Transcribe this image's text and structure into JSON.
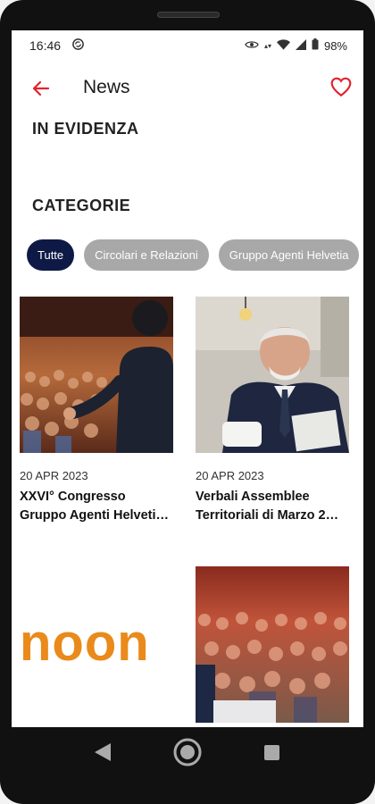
{
  "status": {
    "time": "16:46",
    "battery": "98%"
  },
  "appbar": {
    "title": "News"
  },
  "sections": {
    "featured": "IN EVIDENZA",
    "categories": "CATEGORIE"
  },
  "chips": [
    "Tutte",
    "Circolari e Relazioni",
    "Gruppo Agenti Helvetia"
  ],
  "cards": [
    {
      "date": "20 APR 2023",
      "title": "XXVI° Congresso\nGruppo Agenti Helveti…"
    },
    {
      "date": "20 APR 2023",
      "title": "Verbali Assemblee\nTerritoriali di Marzo 2…"
    }
  ],
  "logo_text": "noon",
  "colors": {
    "accent": "#e3222e",
    "chip_active": "#0e1a45",
    "chip_inactive": "#a8a8a8",
    "logo": "#e98a1a"
  }
}
